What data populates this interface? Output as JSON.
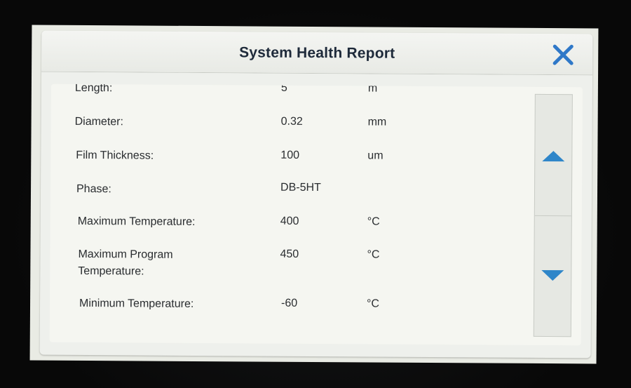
{
  "dialog": {
    "title": "System Health Report",
    "close_icon": "close-icon"
  },
  "rows": [
    {
      "label": "Length:",
      "value": "5",
      "unit": "m"
    },
    {
      "label": "Diameter:",
      "value": "0.32",
      "unit": "mm"
    },
    {
      "label": "Film Thickness:",
      "value": "100",
      "unit": "um"
    },
    {
      "label": "Phase:",
      "value": "DB-5HT",
      "unit": ""
    },
    {
      "label": "Maximum Temperature:",
      "value": "400",
      "unit": "°C"
    },
    {
      "label": "Maximum Program Temperature:",
      "value": "450",
      "unit": "°C"
    },
    {
      "label": "Minimum Temperature:",
      "value": "-60",
      "unit": "°C"
    }
  ],
  "scrollbar": {
    "up_icon": "triangle-up-icon",
    "down_icon": "triangle-down-icon"
  },
  "colors": {
    "accent": "#2f86c9",
    "title": "#1e2a3a",
    "close": "#2f78c8"
  }
}
